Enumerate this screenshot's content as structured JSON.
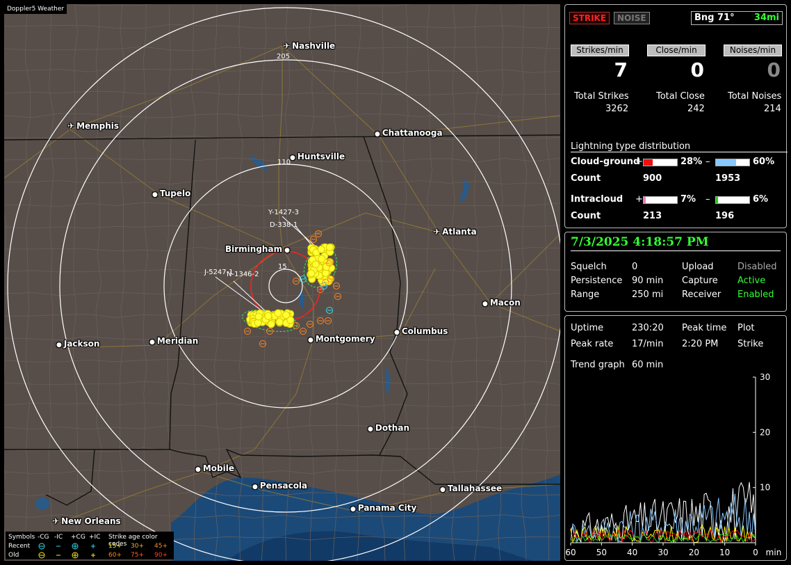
{
  "app_title": "Doppler5 Weather",
  "map": {
    "cities": [
      {
        "name": "Nashville",
        "type": "airport"
      },
      {
        "name": "Memphis",
        "type": "airport"
      },
      {
        "name": "Chattanooga",
        "type": "dot"
      },
      {
        "name": "Huntsville",
        "type": "dot"
      },
      {
        "name": "Tupelo",
        "type": "dot"
      },
      {
        "name": "Birmingham",
        "type": "dot"
      },
      {
        "name": "Atlanta",
        "type": "airport"
      },
      {
        "name": "Macon",
        "type": "dot"
      },
      {
        "name": "Jackson",
        "type": "dot"
      },
      {
        "name": "Meridian",
        "type": "dot"
      },
      {
        "name": "Montgomery",
        "type": "dot"
      },
      {
        "name": "Columbus",
        "type": "dot"
      },
      {
        "name": "Dothan",
        "type": "dot"
      },
      {
        "name": "Mobile",
        "type": "dot"
      },
      {
        "name": "Pensacola",
        "type": "dot"
      },
      {
        "name": "Tallahassee",
        "type": "dot"
      },
      {
        "name": "Panama City",
        "type": "dot"
      },
      {
        "name": "New Orleans",
        "type": "airport"
      }
    ],
    "ring_labels": {
      "r205": "205",
      "r110": "110",
      "r15": "15"
    },
    "storm_labels": {
      "y": "Y-1427-3",
      "d": "D-338-1",
      "j": "J-5247-1",
      "n": "N-1346-2"
    }
  },
  "legend": {
    "symbols_label": "Symbols",
    "cols": [
      "-CG",
      "-IC",
      "+CG",
      "+IC"
    ],
    "recent_label": "Recent",
    "old_label": "Old",
    "age_label": "Strike age color codes",
    "recent_ages": [
      "15+",
      "30+",
      "45+"
    ],
    "old_ages": [
      "60+",
      "75+",
      "90+"
    ]
  },
  "top": {
    "strike_tab": "STRIKE",
    "noise_tab": "NOISE",
    "bearing": "Bng 71°",
    "distance": "34mi",
    "headers": [
      "Strikes/min",
      "Close/min",
      "Noises/min"
    ],
    "values": [
      "7",
      "0",
      "0"
    ],
    "total_labels": [
      "Total Strikes",
      "Total Close",
      "Total Noises"
    ],
    "totals": [
      "3262",
      "242",
      "214"
    ],
    "dist_title": "Lightning type distribution",
    "cg_label": "Cloud-ground",
    "cg_pos_pct": "28%",
    "cg_neg_pct": "60%",
    "cg_pos_frac": 0.28,
    "cg_neg_frac": 0.6,
    "count_label": "Count",
    "cg_pos_count": "900",
    "cg_neg_count": "1953",
    "ic_label": "Intracloud",
    "ic_pos_pct": "7%",
    "ic_neg_pct": "6%",
    "ic_pos_frac": 0.07,
    "ic_neg_frac": 0.06,
    "ic_pos_count": "213",
    "ic_neg_count": "196",
    "plus": "+",
    "minus": "–",
    "colors": {
      "cg_pos": "#ee1111",
      "cg_neg": "#88c8ff",
      "ic_pos": "#ff77bb",
      "ic_neg": "#22cc22"
    }
  },
  "status": {
    "datetime": "7/3/2025 4:18:57 PM",
    "squelch_label": "Squelch",
    "squelch": "0",
    "persistence_label": "Persistence",
    "persistence": "90 min",
    "range_label": "Range",
    "range": "250 mi",
    "upload_label": "Upload",
    "upload": "Disabled",
    "capture_label": "Capture",
    "capture": "Active",
    "receiver_label": "Receiver",
    "receiver": "Enabled"
  },
  "stats": {
    "uptime_label": "Uptime",
    "uptime": "230:20",
    "peak_time_label": "Peak time",
    "peak_time": "2:20 PM",
    "plot_label": "Plot",
    "plot": "Strike",
    "peak_rate_label": "Peak rate",
    "peak_rate": "17/min",
    "trend_label": "Trend graph",
    "trend": "60 min"
  },
  "chart_data": {
    "type": "line",
    "x_ticks": [
      "60",
      "50",
      "40",
      "30",
      "20",
      "10",
      "0"
    ],
    "x_unit": "min",
    "y_ticks": [
      "30",
      "20",
      "10"
    ],
    "ylim": [
      0,
      30
    ],
    "series_colors": [
      "#ffffff",
      "#88c8ff",
      "#ffff00",
      "#ee1111",
      "#22cc22"
    ]
  }
}
